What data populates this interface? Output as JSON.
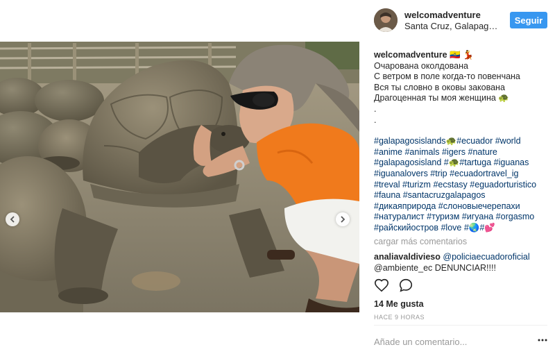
{
  "header": {
    "username": "welcomadventure",
    "location": "Santa Cruz, Galapagos Islands",
    "follow_label": "Seguir"
  },
  "caption": {
    "username": "welcomadventure",
    "emojis": "🇪🇨 💃",
    "lines": [
      "Очарована околдована",
      "С ветром в поле когда-то повенчана",
      "Вся ты словно в оковы закована",
      "Драгоценная ты моя женщина 🐢",
      ".",
      "."
    ],
    "hashtag_lines": [
      "#galapagosislands🐢#ecuador #world",
      "#anime #animals #igers #nature",
      "#galapagosisland #🐢#tartuga #iguanas",
      "#iguanalovers #trip #ecuadortravel_ig",
      "#treval #turizm #ecstasy #eguadorturistico",
      "#fauna #santacruzgalapagos",
      "#дикаяприрода #слоновыечерепахи",
      "#натуралист #туризм #игуана #orgasmo",
      "#райскийостров #love #🌏#💕"
    ]
  },
  "load_more_label": "cargar más comentarios",
  "comment": {
    "username": "analiavaldivieso",
    "mention": "@policiaecuadoroficial",
    "line2": "@ambiente_ec DENUNCIAR!!!!"
  },
  "likes_label": "14 Me gusta",
  "timestamp": "HACE 9 HORAS",
  "comment_placeholder": "Añade un comentario...",
  "icons": {
    "like": "heart-icon",
    "comment": "speech-bubble-icon",
    "carousel_prev": "chevron-left-icon",
    "carousel_next": "chevron-right-icon",
    "more": "ellipsis-icon"
  },
  "colors": {
    "follow_button": "#3897f0",
    "hashtag": "#003569",
    "muted": "#999999",
    "text": "#262626"
  }
}
